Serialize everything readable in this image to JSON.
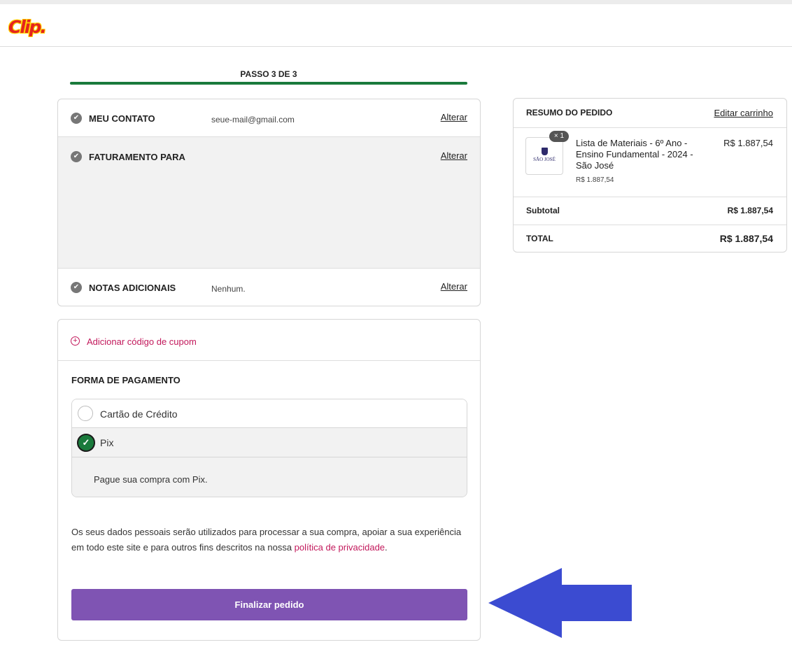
{
  "brand": {
    "logo_text": "Clip."
  },
  "progress": {
    "step_label": "PASSO 3 DE 3",
    "fraction": 1.0
  },
  "steps": {
    "contact": {
      "label": "MEU CONTATO",
      "value": "seue-mail@gmail.com",
      "action": "Alterar"
    },
    "billing": {
      "label": "FATURAMENTO PARA",
      "action": "Alterar"
    },
    "notes": {
      "label": "NOTAS ADICIONAIS",
      "value": "Nenhum.",
      "action": "Alterar"
    }
  },
  "coupon": {
    "label": "Adicionar código de cupom"
  },
  "payment": {
    "title": "FORMA DE PAGAMENTO",
    "options": [
      {
        "label": "Cartão de Crédito",
        "selected": false
      },
      {
        "label": "Pix",
        "selected": true
      }
    ],
    "pix_description": "Pague sua compra com Pix."
  },
  "privacy": {
    "text": "Os seus dados pessoais serão utilizados para processar a sua compra, apoiar a sua experiência em todo este site e para outros fins descritos na nossa ",
    "link": "política de privacidade",
    "end": "."
  },
  "submit": {
    "label": "Finalizar pedido"
  },
  "order": {
    "title": "RESUMO DO PEDIDO",
    "edit_cart": "Editar carrinho",
    "item": {
      "name": "Lista de Materiais - 6º Ano - Ensino Fundamental - 2024 - São José",
      "price": "R$ 1.887,54",
      "unit_price": "R$ 1.887,54",
      "quantity": "× 1",
      "thumb_brand": "SÃO JOSÉ"
    },
    "subtotal_label": "Subtotal",
    "subtotal_value": "R$ 1.887,54",
    "total_label": "TOTAL",
    "total_value": "R$ 1.887,54"
  },
  "colors": {
    "progress": "#1a7a3c",
    "accent_link": "#c2185b",
    "button": "#7f54b3",
    "annotation_arrow": "#3b4bd1"
  },
  "icons": {
    "step_check": "check-circle-icon",
    "coupon": "plus-circle-icon",
    "radio_selected": "check-icon",
    "annotation": "arrow-left-icon"
  }
}
